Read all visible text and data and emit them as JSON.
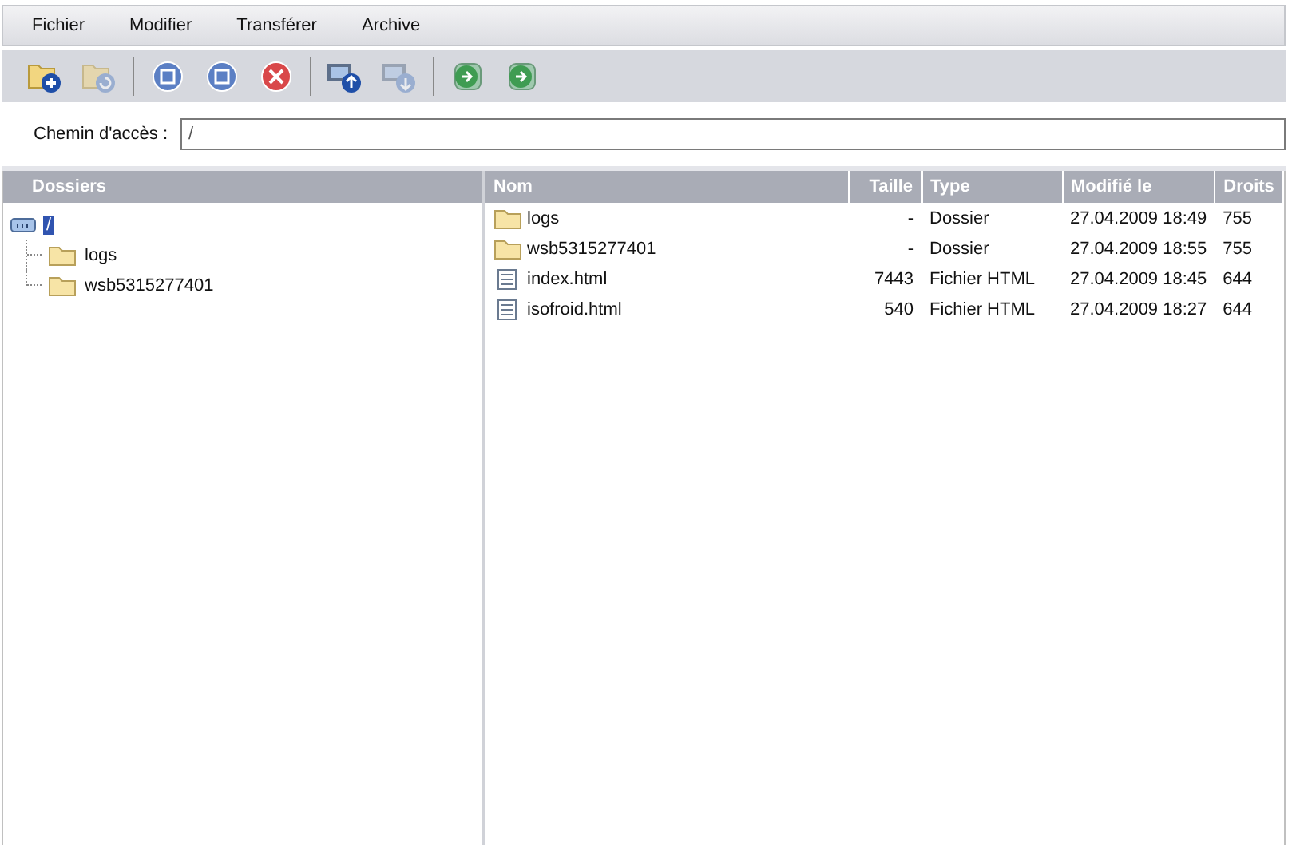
{
  "menu": [
    {
      "label": "Fichier"
    },
    {
      "label": "Modifier"
    },
    {
      "label": "Transférer"
    },
    {
      "label": "Archive"
    }
  ],
  "toolbar": [
    {
      "kind": "button",
      "disabled": false
    },
    {
      "kind": "button",
      "disabled": true
    },
    {
      "kind": "separator"
    },
    {
      "kind": "button",
      "disabled": false
    },
    {
      "kind": "button",
      "disabled": false
    },
    {
      "kind": "button",
      "disabled": false
    },
    {
      "kind": "separator"
    },
    {
      "kind": "button",
      "disabled": false
    },
    {
      "kind": "button",
      "disabled": true
    },
    {
      "kind": "separator"
    },
    {
      "kind": "button",
      "disabled": false
    },
    {
      "kind": "button",
      "disabled": false
    }
  ],
  "path": {
    "label": "Chemin d'accès :",
    "value": "/"
  },
  "folders": {
    "title": "Dossiers",
    "root": {
      "label": "/",
      "selected": true,
      "children": [
        {
          "label": "logs",
          "selected": false
        },
        {
          "label": "wsb5315277401",
          "selected": false
        }
      ]
    }
  },
  "files": {
    "columns": [
      "Nom",
      "Taille",
      "Type",
      "Modifié le",
      "Droits"
    ],
    "rows": [
      {
        "kind": "folder",
        "name": "logs",
        "size": "-",
        "type": "Dossier",
        "modified": "27.04.2009 18:49",
        "rights": "755"
      },
      {
        "kind": "folder",
        "name": "wsb5315277401",
        "size": "-",
        "type": "Dossier",
        "modified": "27.04.2009 18:55",
        "rights": "755"
      },
      {
        "kind": "file",
        "name": "index.html",
        "size": "7443",
        "type": "Fichier HTML",
        "modified": "27.04.2009 18:45",
        "rights": "644"
      },
      {
        "kind": "file",
        "name": "isofroid.html",
        "size": "540",
        "type": "Fichier HTML",
        "modified": "27.04.2009 18:27",
        "rights": "644"
      }
    ]
  }
}
